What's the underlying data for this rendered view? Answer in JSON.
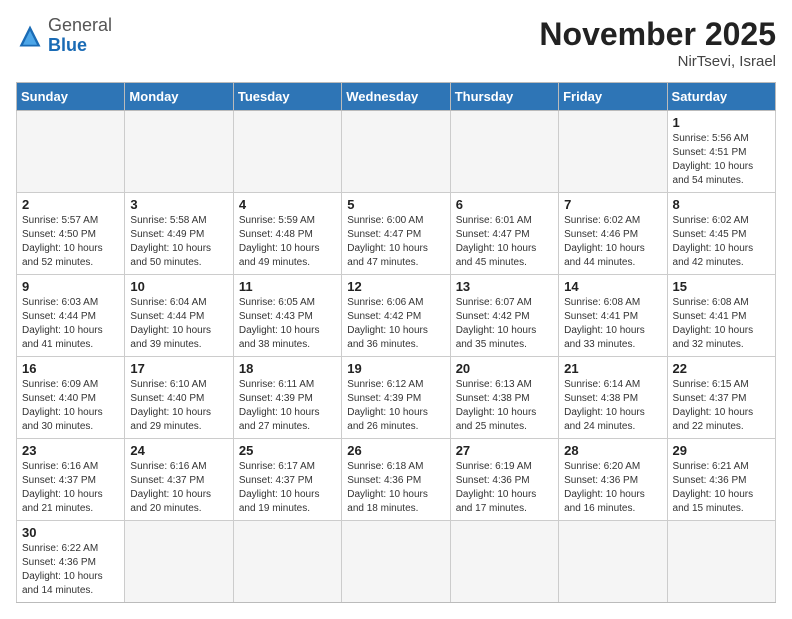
{
  "header": {
    "logo_general": "General",
    "logo_blue": "Blue",
    "month_title": "November 2025",
    "location": "NirTsevi, Israel"
  },
  "days_of_week": [
    "Sunday",
    "Monday",
    "Tuesday",
    "Wednesday",
    "Thursday",
    "Friday",
    "Saturday"
  ],
  "weeks": [
    [
      {
        "day": "",
        "info": ""
      },
      {
        "day": "",
        "info": ""
      },
      {
        "day": "",
        "info": ""
      },
      {
        "day": "",
        "info": ""
      },
      {
        "day": "",
        "info": ""
      },
      {
        "day": "",
        "info": ""
      },
      {
        "day": "1",
        "info": "Sunrise: 5:56 AM\nSunset: 4:51 PM\nDaylight: 10 hours\nand 54 minutes."
      }
    ],
    [
      {
        "day": "2",
        "info": "Sunrise: 5:57 AM\nSunset: 4:50 PM\nDaylight: 10 hours\nand 52 minutes."
      },
      {
        "day": "3",
        "info": "Sunrise: 5:58 AM\nSunset: 4:49 PM\nDaylight: 10 hours\nand 50 minutes."
      },
      {
        "day": "4",
        "info": "Sunrise: 5:59 AM\nSunset: 4:48 PM\nDaylight: 10 hours\nand 49 minutes."
      },
      {
        "day": "5",
        "info": "Sunrise: 6:00 AM\nSunset: 4:47 PM\nDaylight: 10 hours\nand 47 minutes."
      },
      {
        "day": "6",
        "info": "Sunrise: 6:01 AM\nSunset: 4:47 PM\nDaylight: 10 hours\nand 45 minutes."
      },
      {
        "day": "7",
        "info": "Sunrise: 6:02 AM\nSunset: 4:46 PM\nDaylight: 10 hours\nand 44 minutes."
      },
      {
        "day": "8",
        "info": "Sunrise: 6:02 AM\nSunset: 4:45 PM\nDaylight: 10 hours\nand 42 minutes."
      }
    ],
    [
      {
        "day": "9",
        "info": "Sunrise: 6:03 AM\nSunset: 4:44 PM\nDaylight: 10 hours\nand 41 minutes."
      },
      {
        "day": "10",
        "info": "Sunrise: 6:04 AM\nSunset: 4:44 PM\nDaylight: 10 hours\nand 39 minutes."
      },
      {
        "day": "11",
        "info": "Sunrise: 6:05 AM\nSunset: 4:43 PM\nDaylight: 10 hours\nand 38 minutes."
      },
      {
        "day": "12",
        "info": "Sunrise: 6:06 AM\nSunset: 4:42 PM\nDaylight: 10 hours\nand 36 minutes."
      },
      {
        "day": "13",
        "info": "Sunrise: 6:07 AM\nSunset: 4:42 PM\nDaylight: 10 hours\nand 35 minutes."
      },
      {
        "day": "14",
        "info": "Sunrise: 6:08 AM\nSunset: 4:41 PM\nDaylight: 10 hours\nand 33 minutes."
      },
      {
        "day": "15",
        "info": "Sunrise: 6:08 AM\nSunset: 4:41 PM\nDaylight: 10 hours\nand 32 minutes."
      }
    ],
    [
      {
        "day": "16",
        "info": "Sunrise: 6:09 AM\nSunset: 4:40 PM\nDaylight: 10 hours\nand 30 minutes."
      },
      {
        "day": "17",
        "info": "Sunrise: 6:10 AM\nSunset: 4:40 PM\nDaylight: 10 hours\nand 29 minutes."
      },
      {
        "day": "18",
        "info": "Sunrise: 6:11 AM\nSunset: 4:39 PM\nDaylight: 10 hours\nand 27 minutes."
      },
      {
        "day": "19",
        "info": "Sunrise: 6:12 AM\nSunset: 4:39 PM\nDaylight: 10 hours\nand 26 minutes."
      },
      {
        "day": "20",
        "info": "Sunrise: 6:13 AM\nSunset: 4:38 PM\nDaylight: 10 hours\nand 25 minutes."
      },
      {
        "day": "21",
        "info": "Sunrise: 6:14 AM\nSunset: 4:38 PM\nDaylight: 10 hours\nand 24 minutes."
      },
      {
        "day": "22",
        "info": "Sunrise: 6:15 AM\nSunset: 4:37 PM\nDaylight: 10 hours\nand 22 minutes."
      }
    ],
    [
      {
        "day": "23",
        "info": "Sunrise: 6:16 AM\nSunset: 4:37 PM\nDaylight: 10 hours\nand 21 minutes."
      },
      {
        "day": "24",
        "info": "Sunrise: 6:16 AM\nSunset: 4:37 PM\nDaylight: 10 hours\nand 20 minutes."
      },
      {
        "day": "25",
        "info": "Sunrise: 6:17 AM\nSunset: 4:37 PM\nDaylight: 10 hours\nand 19 minutes."
      },
      {
        "day": "26",
        "info": "Sunrise: 6:18 AM\nSunset: 4:36 PM\nDaylight: 10 hours\nand 18 minutes."
      },
      {
        "day": "27",
        "info": "Sunrise: 6:19 AM\nSunset: 4:36 PM\nDaylight: 10 hours\nand 17 minutes."
      },
      {
        "day": "28",
        "info": "Sunrise: 6:20 AM\nSunset: 4:36 PM\nDaylight: 10 hours\nand 16 minutes."
      },
      {
        "day": "29",
        "info": "Sunrise: 6:21 AM\nSunset: 4:36 PM\nDaylight: 10 hours\nand 15 minutes."
      }
    ],
    [
      {
        "day": "30",
        "info": "Sunrise: 6:22 AM\nSunset: 4:36 PM\nDaylight: 10 hours\nand 14 minutes."
      },
      {
        "day": "",
        "info": ""
      },
      {
        "day": "",
        "info": ""
      },
      {
        "day": "",
        "info": ""
      },
      {
        "day": "",
        "info": ""
      },
      {
        "day": "",
        "info": ""
      },
      {
        "day": "",
        "info": ""
      }
    ]
  ]
}
